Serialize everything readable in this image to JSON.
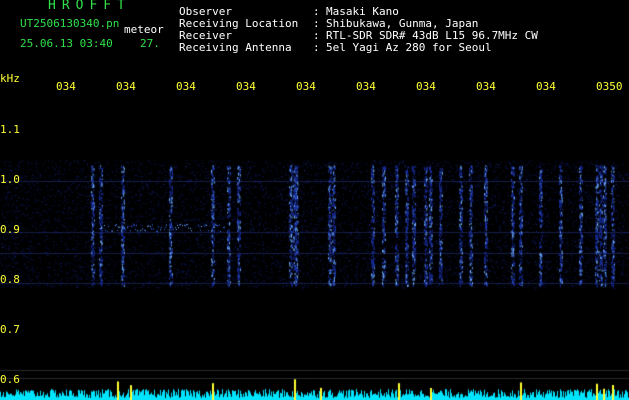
{
  "header": {
    "brand": "HROFFT",
    "filename": "UT2506130340.pn",
    "tag": "meteor",
    "timestamp": "25.06.13 03:40",
    "count": "27."
  },
  "info": [
    {
      "label": "Observer",
      "sep": ":",
      "value": "Masaki Kano"
    },
    {
      "label": "Receiving Location",
      "sep": ":",
      "value": "Shibukawa, Gunma, Japan"
    },
    {
      "label": "Receiver",
      "sep": ":",
      "value": "RTL-SDR SDR# 43dB L15 96.7MHz CW"
    },
    {
      "label": "Receiving Antenna",
      "sep": ":",
      "value": "5el Yagi Az 280 for Seoul"
    }
  ],
  "axis": {
    "unit": "kHz",
    "time_ticks": [
      "034",
      "034",
      "034",
      "034",
      "034",
      "034",
      "034",
      "034",
      "034",
      "0350"
    ],
    "freq_ticks": [
      "1.1",
      "1.0",
      "0.9",
      "0.8",
      "0.7",
      "0.6"
    ]
  },
  "colors": {
    "background": "#000000",
    "header_text": "#ffffff",
    "brand_text": "#2fe04a",
    "tick_text": "#ffff33",
    "signal_dark": "#1a2fa0",
    "signal_bright": "#6fb0ff",
    "baseline_cyan": "#00e5ff"
  }
}
